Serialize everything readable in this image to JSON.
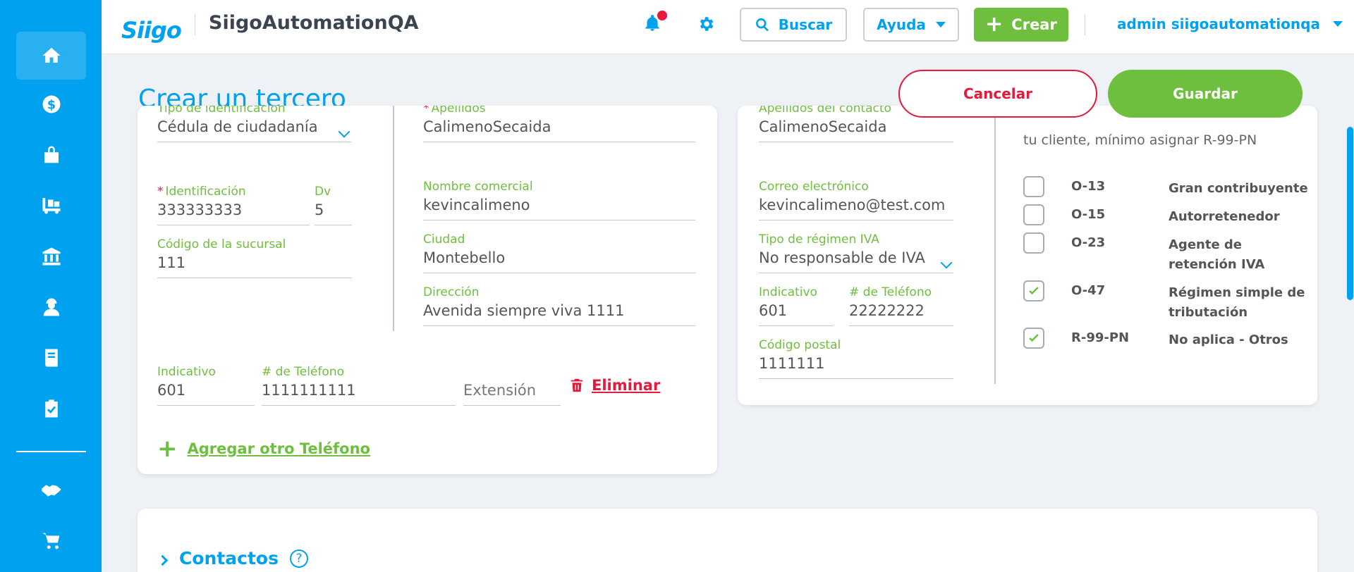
{
  "sidebar": {
    "items": [
      {
        "icon": "home-icon",
        "active": true
      },
      {
        "icon": "dollar-icon"
      },
      {
        "icon": "shopping-bag-icon"
      },
      {
        "icon": "forklift-icon"
      },
      {
        "icon": "bank-icon"
      },
      {
        "icon": "worker-icon"
      },
      {
        "icon": "book-icon"
      },
      {
        "icon": "clipboard-check-icon"
      },
      {
        "icon": "handshake-icon"
      },
      {
        "icon": "cart-icon"
      }
    ]
  },
  "header": {
    "logo_text": "Siigo",
    "company": "SiigoAutomationQA",
    "search_label": "Buscar",
    "help_label": "Ayuda",
    "create_label": "Crear",
    "user_label": "admin siigoautomationqa"
  },
  "page": {
    "title": "Crear un tercero",
    "cancel_label": "Cancelar",
    "save_label": "Guardar"
  },
  "left_card": {
    "id_type": {
      "label": "Tipo de identificación",
      "value": "Cédula de ciudadanía"
    },
    "identification": {
      "label": "Identificación",
      "value": "333333333"
    },
    "dv": {
      "label": "Dv",
      "value": "5"
    },
    "branch_code": {
      "label": "Código de la sucursal",
      "value": "111"
    },
    "last_names": {
      "label": "Apellidos",
      "value": "CalimenoSecaida"
    },
    "trade_name": {
      "label": "Nombre comercial",
      "value": "kevincalimeno"
    },
    "city": {
      "label": "Ciudad",
      "value": "Montebello"
    },
    "address": {
      "label": "Dirección",
      "value": "Avenida siempre viva 1111"
    },
    "phone_prefix": {
      "label": "Indicativo",
      "value": "601"
    },
    "phone_number": {
      "label": "# de Teléfono",
      "value": "1111111111"
    },
    "extension_placeholder": "Extensión",
    "delete_label": "Eliminar",
    "add_phone_label": "Agregar otro Teléfono"
  },
  "right_card": {
    "contact_last_names": {
      "label": "Apellidos del contacto",
      "value": "CalimenoSecaida"
    },
    "email": {
      "label": "Correo electrónico",
      "value": "kevincalimeno@test.com"
    },
    "vat_regime": {
      "label": "Tipo de régimen IVA",
      "value": "No responsable de IVA"
    },
    "phone_prefix": {
      "label": "Indicativo",
      "value": "601"
    },
    "phone_number": {
      "label": "# de Teléfono",
      "value": "22222222"
    },
    "postal_code": {
      "label": "Código postal",
      "value": "1111111"
    },
    "responsibilities_hint": "tu cliente, mínimo asignar R-99-PN",
    "responsibilities": [
      {
        "code": "O-13",
        "desc": "Gran contribuyente",
        "checked": false
      },
      {
        "code": "O-15",
        "desc": "Autorretenedor",
        "checked": false
      },
      {
        "code": "O-23",
        "desc": "Agente de retención IVA",
        "checked": false
      },
      {
        "code": "O-47",
        "desc": "Régimen simple de tributación",
        "checked": true
      },
      {
        "code": "R-99-PN",
        "desc": "No aplica - Otros",
        "checked": true
      }
    ]
  },
  "contacts": {
    "title": "Contactos",
    "help": "?"
  },
  "colors": {
    "brand_blue": "#00a1ef",
    "green": "#6fbf3e",
    "red": "#e6183c"
  }
}
